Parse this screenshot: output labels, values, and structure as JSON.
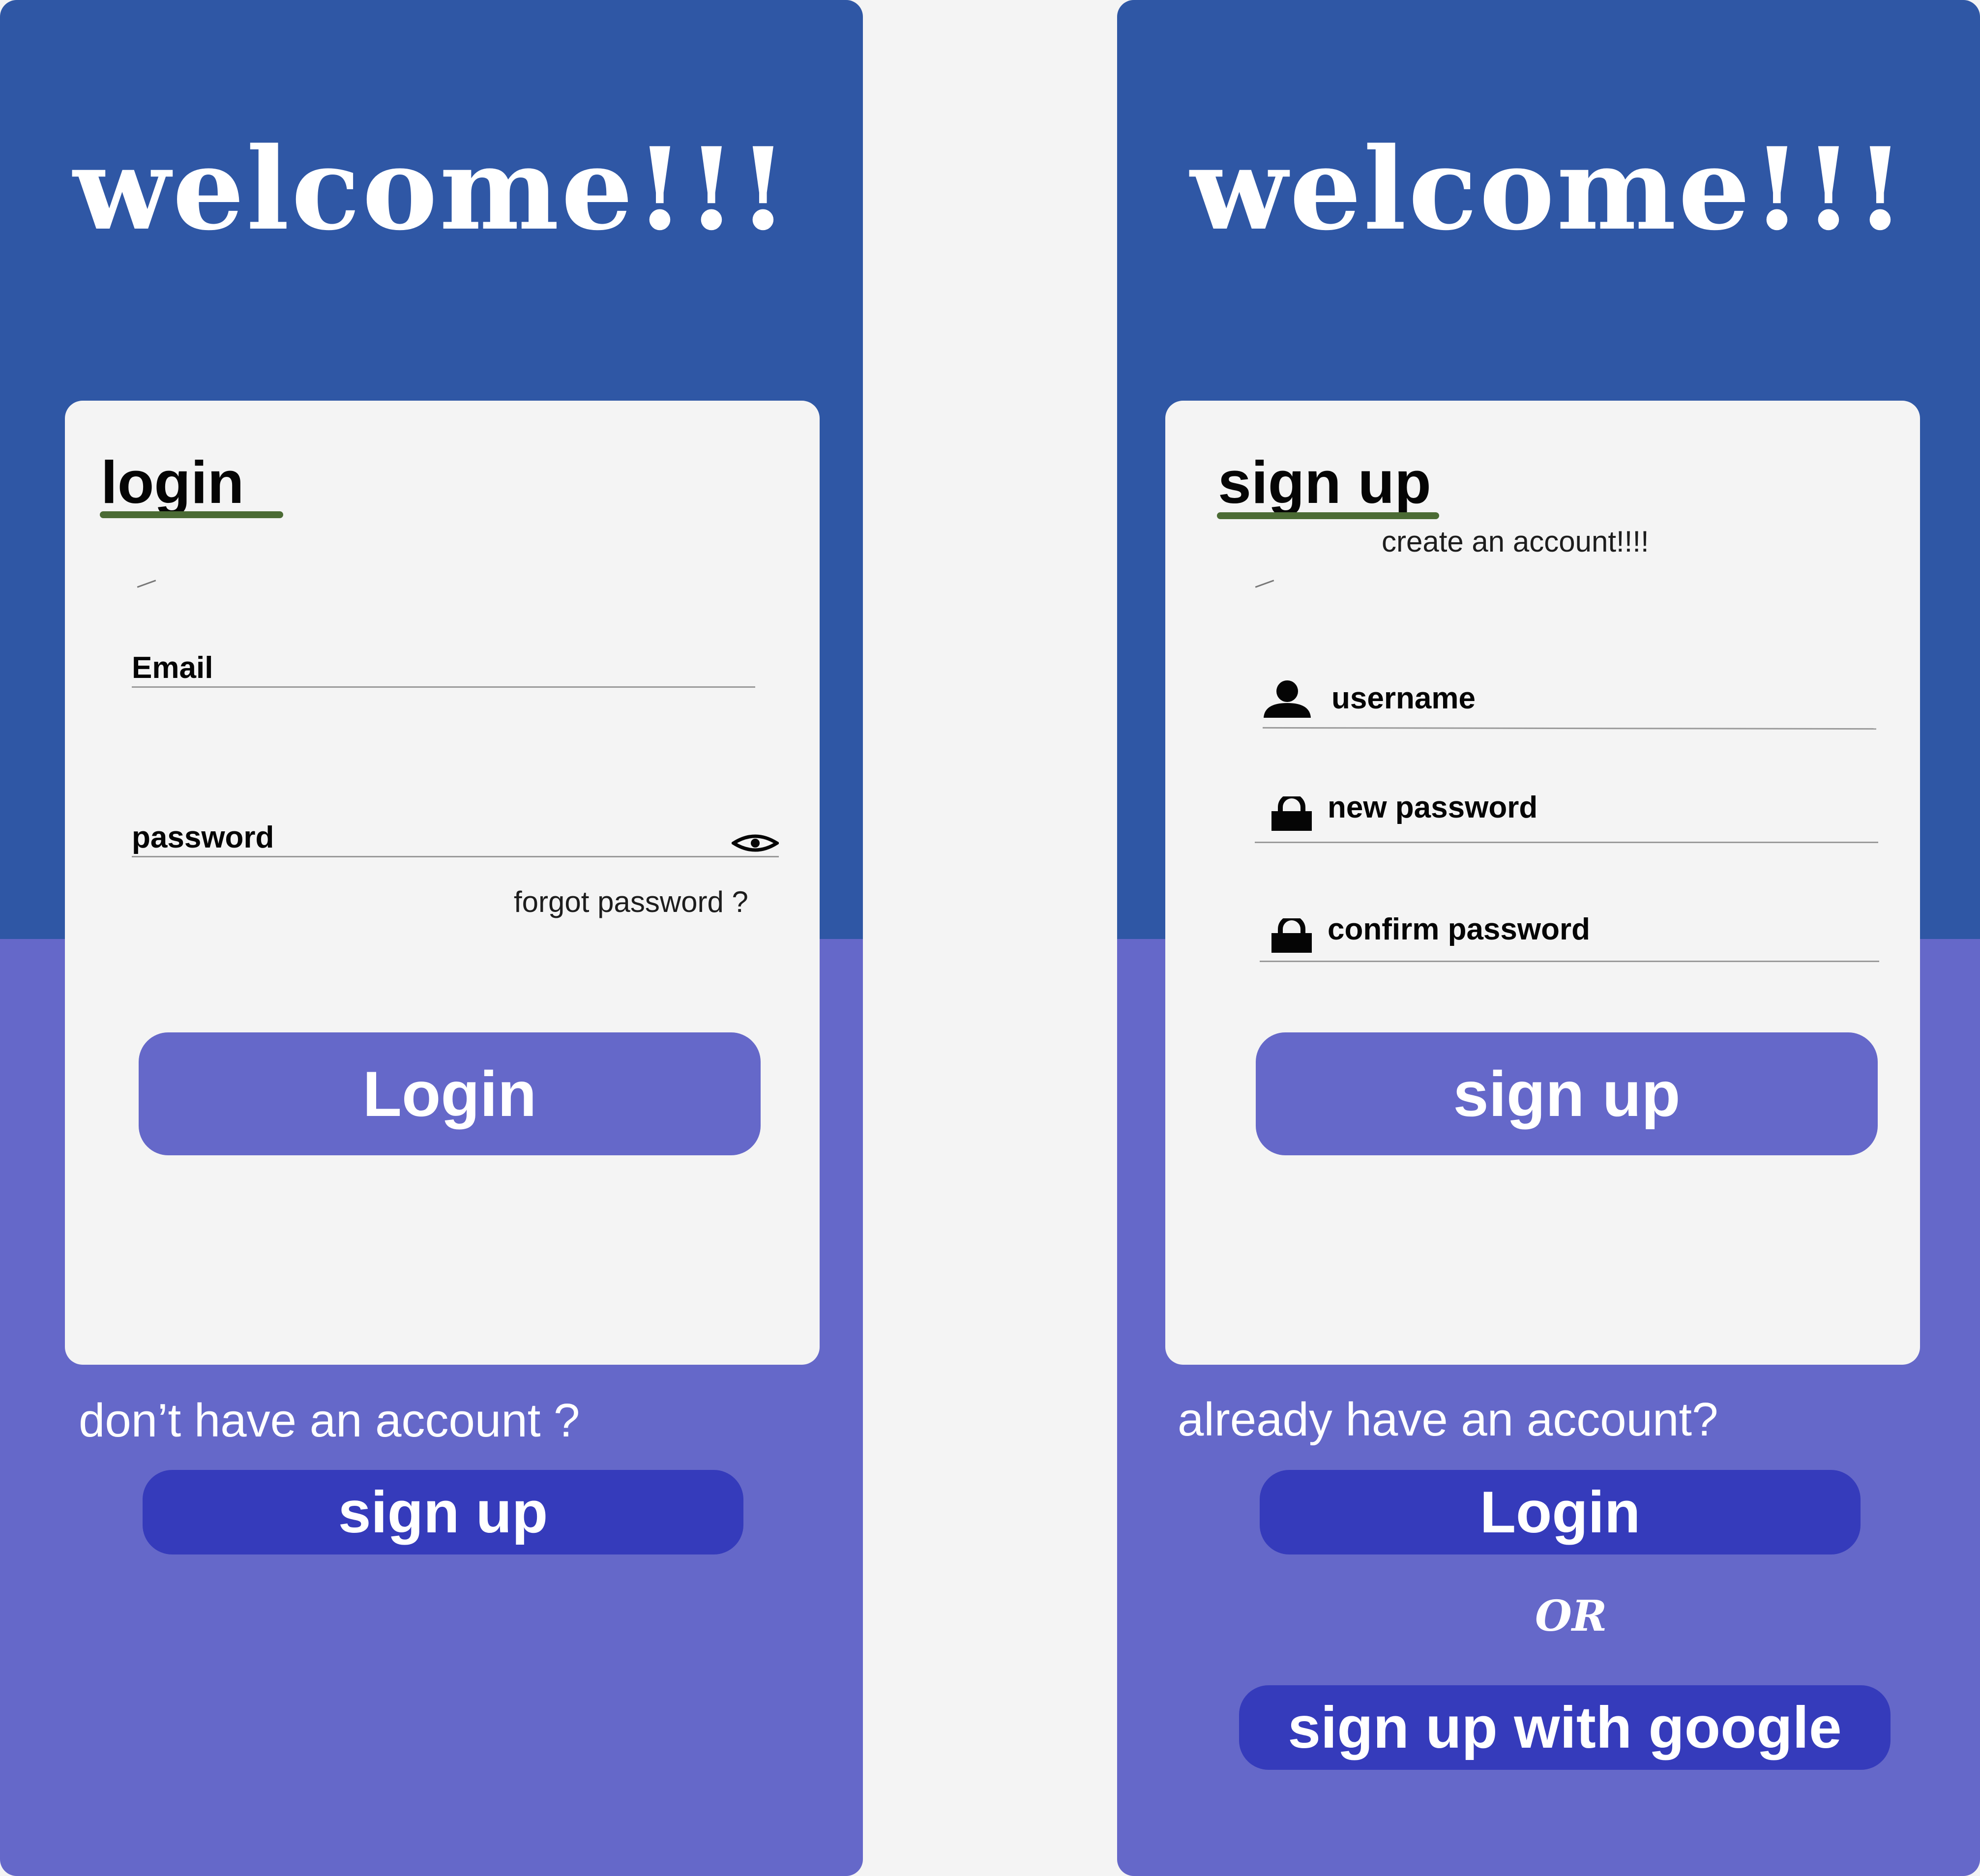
{
  "colors": {
    "background": "#f4f4f4",
    "panel_top": "#2f57a5",
    "panel_bottom": "#6568c9",
    "card": "#f4f4f4",
    "primary_button": "#6568c9",
    "secondary_button": "#353bbb",
    "underline": "#4b6b34",
    "text": "#050505"
  },
  "login_screen": {
    "welcome": "welcome!!!",
    "title": "login",
    "email_label": "Email",
    "password_label": "password",
    "password_toggle_icon": "eye-icon",
    "forgot_password": "forgot password ?",
    "login_button": "Login",
    "prompt": "don’t have an account ?",
    "signup_button": "sign up"
  },
  "signup_screen": {
    "welcome": "welcome!!!",
    "title": "sign up",
    "subtitle": "create an account!!!!",
    "username_label": "username",
    "username_icon": "user-icon",
    "new_password_label": "new password",
    "new_password_icon": "lock-icon",
    "confirm_password_label": "confirm password",
    "confirm_password_icon": "lock-icon",
    "signup_button": "sign up",
    "prompt": "already have an account?",
    "login_button": "Login",
    "or_text": "OR",
    "google_button": "sign up with google"
  }
}
